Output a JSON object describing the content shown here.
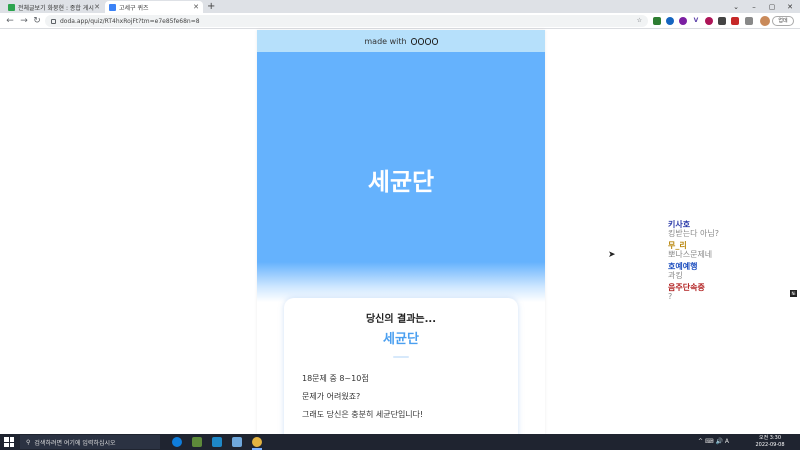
{
  "browser": {
    "tabs": [
      {
        "title": "전체글보기 화뭉현 : 종합 게시판",
        "favicon_color": "#2da44e"
      },
      {
        "title": "고세구 퀴즈",
        "favicon_color": "#3b82f6"
      }
    ],
    "new_tab": "+",
    "url": "doda.app/quiz/RT4hxRojFt?tm=e7e85fe68n=8",
    "update_label": "업데",
    "window_controls": [
      "⌄",
      "–",
      "▢",
      "✕"
    ]
  },
  "quiz": {
    "made_with": "made with",
    "hero_title": "세균단",
    "result_intro": "당신의 결과는...",
    "result_name": "세균단",
    "lines": [
      "18문제 중 8~10점",
      "문제가 어려웠죠?",
      "그래도 당신은 충분히 세균단입니다!"
    ],
    "hero_color": "#65b2fd",
    "header_color": "#b6e0fb"
  },
  "comments": [
    {
      "name": "키사호",
      "text": "킹받는다 아님?",
      "color": "#2b3aa8"
    },
    {
      "name": "무_리",
      "text": "뽀나스문제네",
      "color": "#b8860b"
    },
    {
      "name": "호예예행",
      "text": "과킹",
      "color": "#1e4fbf"
    },
    {
      "name": "음주단속중",
      "text": "?",
      "color": "#b22222"
    }
  ],
  "side_badge": "Ni",
  "taskbar": {
    "search_placeholder": "검색하려면 여기에 입력하십시오",
    "time": "오전 3:30",
    "date": "2022-09-08",
    "tray": "^ ⌨ 🔊 A"
  }
}
